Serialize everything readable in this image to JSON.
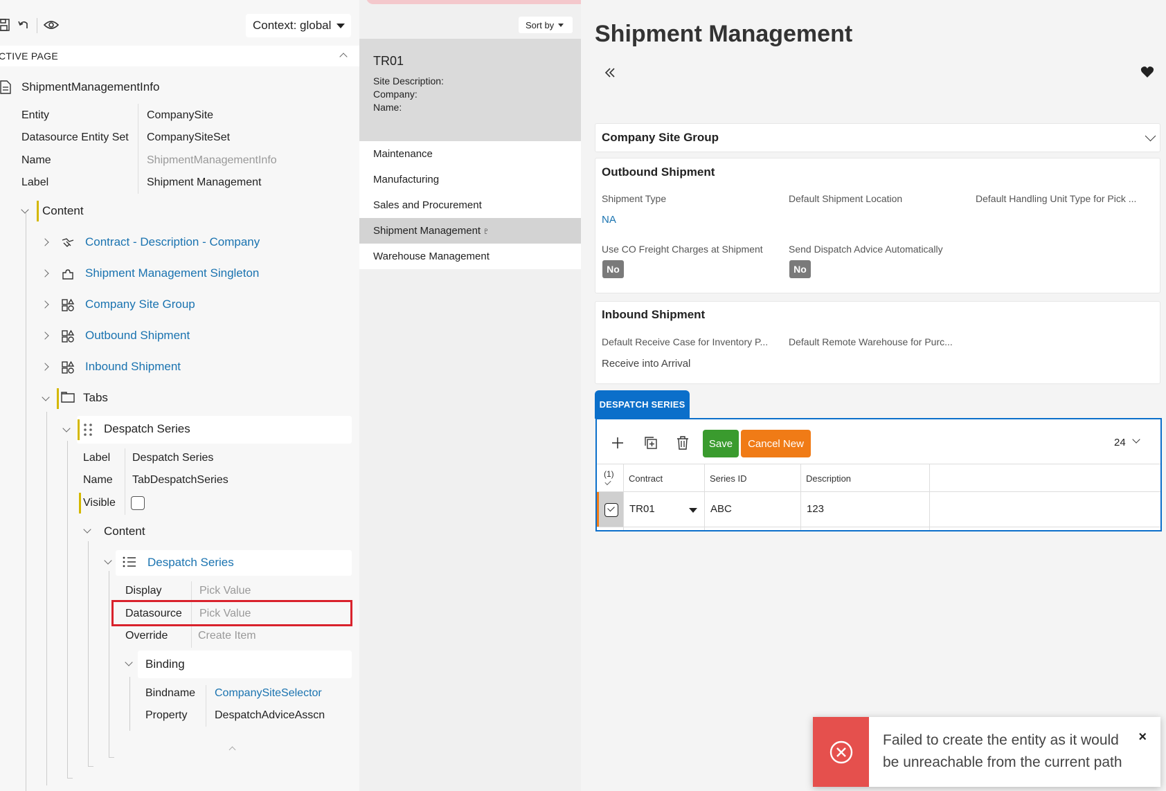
{
  "toolbar": {
    "context_label": "Context: global"
  },
  "active_page": {
    "label": "CTIVE PAGE",
    "page_name": "ShipmentManagementInfo",
    "props": [
      {
        "key": "Entity",
        "value": "CompanySite"
      },
      {
        "key": "Datasource Entity Set",
        "value": "CompanySiteSet"
      },
      {
        "key": "Name",
        "value": "ShipmentManagementInfo"
      },
      {
        "key": "Label",
        "value": "Shipment Management"
      }
    ]
  },
  "tree": {
    "content": "Content",
    "items": [
      "Contract - Description - Company",
      "Shipment Management Singleton",
      "Company Site Group",
      "Outbound Shipment",
      "Inbound Shipment"
    ],
    "tabs": "Tabs",
    "despatch_series": "Despatch Series",
    "tab_props": [
      {
        "key": "Label",
        "value": "Despatch Series"
      },
      {
        "key": "Name",
        "value": "TabDespatchSeries"
      },
      {
        "key": "Visible",
        "value": ""
      }
    ],
    "content2": "Content",
    "list_name": "Despatch Series",
    "list_props": [
      {
        "key": "Display",
        "value": "Pick Value"
      },
      {
        "key": "Datasource",
        "value": "Pick Value"
      },
      {
        "key": "Override",
        "value": "Create Item"
      }
    ],
    "binding": "Binding",
    "binding_props": [
      {
        "key": "Bindname",
        "value": "CompanySiteSelector"
      },
      {
        "key": "Property",
        "value": "DespatchAdviceAsscn"
      }
    ]
  },
  "middle": {
    "sort_by": "Sort by",
    "record": {
      "title": "TR01",
      "lines": [
        "Site Description:",
        "Company:",
        "Name:"
      ]
    },
    "menu": [
      "Maintenance",
      "Manufacturing",
      "Sales and Procurement",
      "Shipment Management",
      "Warehouse Management"
    ],
    "selected_index": 3,
    "pin_glyph": "♇"
  },
  "main": {
    "title": "Shipment Management",
    "company_site_group": "Company Site Group",
    "outbound": {
      "title": "Outbound Shipment",
      "labels": [
        "Shipment Type",
        "Default Shipment Location",
        "Default Handling Unit Type for Pick ..."
      ],
      "shipment_type": "NA",
      "labels2": [
        "Use CO Freight Charges at Shipment",
        "Send Dispatch Advice Automatically"
      ],
      "freight": "No",
      "dispatch": "No"
    },
    "inbound": {
      "title": "Inbound Shipment",
      "labels": [
        "Default Receive Case for Inventory P...",
        "Default Remote Warehouse for Purc..."
      ],
      "receive_case": "Receive into Arrival"
    },
    "tab_label": "DESPATCH SERIES",
    "grid": {
      "save": "Save",
      "cancel_new": "Cancel New",
      "page_size": "24",
      "selected_count": "(1)",
      "columns": [
        "Contract",
        "Series ID",
        "Description"
      ],
      "row": {
        "contract": "TR01",
        "series_id": "ABC",
        "description": "123"
      }
    }
  },
  "toast": {
    "message": "Failed to create the entity as it would be unreachable from the current path",
    "close": "×"
  },
  "colors": {
    "accent": "#0b6fca",
    "save": "#3a9b2e",
    "cancel": "#f07b16",
    "error": "#e5504d",
    "link": "#1a73b0"
  }
}
